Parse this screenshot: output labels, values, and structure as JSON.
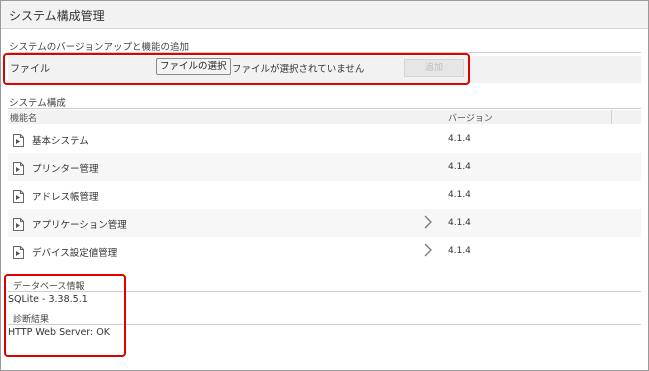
{
  "title": "システム構成管理",
  "upgrade_section": {
    "heading": "システムのバージョンアップと機能の追加",
    "file_label": "ファイル",
    "choose_button": "ファイルの選択",
    "file_status": "ファイルが選択されていません",
    "add_button": "追加"
  },
  "config_section": {
    "heading": "システム構成",
    "columns": [
      "機能名",
      "バージョン"
    ],
    "rows": [
      {
        "name": "基本システム",
        "version": "4.1.4"
      },
      {
        "name": "プリンター管理",
        "version": "4.1.4"
      },
      {
        "name": "アドレス帳管理",
        "version": "4.1.4"
      },
      {
        "name": "アプリケーション管理",
        "version": "4.1.4"
      },
      {
        "name": "デバイス設定値管理",
        "version": "4.1.4"
      }
    ]
  },
  "database_section": {
    "heading": "データベース情報",
    "value": "SQLite - 3.38.5.1"
  },
  "diagnosis_section": {
    "heading": "診断結果",
    "value": "HTTP Web Server: OK"
  },
  "colors": {
    "highlight": "#e00000",
    "header_bg": "#f2f2f2"
  },
  "icons": {
    "row_icon": "document-icon",
    "expand_icon": "chevron-right-icon"
  }
}
